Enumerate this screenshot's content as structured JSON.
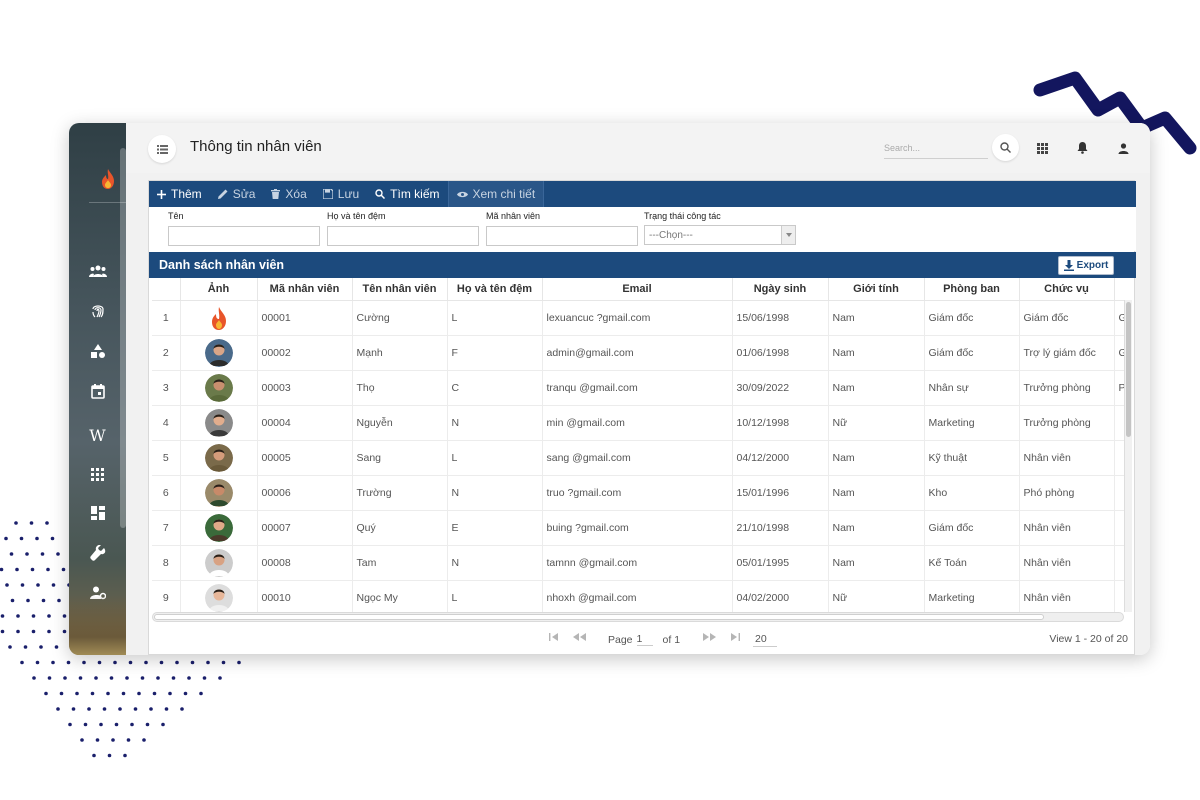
{
  "header": {
    "title": "Thông tin nhân viên",
    "search_placeholder": "Search..."
  },
  "toolbar": {
    "add": "Thêm",
    "edit": "Sửa",
    "delete": "Xóa",
    "save": "Lưu",
    "search": "Tìm kiếm",
    "view_detail": "Xem chi tiết"
  },
  "filters": {
    "first_name_label": "Tên",
    "last_name_label": "Họ và tên đệm",
    "employee_id_label": "Mã nhân viên",
    "status_label": "Trạng thái công tác",
    "status_selected": "---Chọn---"
  },
  "grid": {
    "title": "Danh sách nhân viên",
    "export_label": "Export",
    "columns": [
      "",
      "Ảnh",
      "Mã nhân viên",
      "Tên nhân viên",
      "Họ và tên đệm",
      "Email",
      "Ngày sinh",
      "Giới tính",
      "Phòng ban",
      "Chức vụ",
      ""
    ],
    "rows": [
      {
        "no": "1",
        "avatar": "logo",
        "id": "00001",
        "name": "Cường",
        "middle": "L",
        "email": "lexuancuc             ?gmail.com",
        "dob": "15/06/1998",
        "gender": "Nam",
        "dept": "Giám đốc",
        "position": "Giám đốc",
        "extra": "G"
      },
      {
        "no": "2",
        "avatar": "person",
        "id": "00002",
        "name": "Mạnh",
        "middle": "F",
        "email": "admin@gmail.com",
        "dob": "01/06/1998",
        "gender": "Nam",
        "dept": "Giám đốc",
        "position": "Trợ lý giám đốc",
        "extra": "G"
      },
      {
        "no": "3",
        "avatar": "person",
        "id": "00003",
        "name": "Thọ",
        "middle": "C",
        "email": "tranqu                   @gmail.com",
        "dob": "30/09/2022",
        "gender": "Nam",
        "dept": "Nhân sự",
        "position": "Trưởng phòng",
        "extra": "P"
      },
      {
        "no": "4",
        "avatar": "person",
        "id": "00004",
        "name": "Nguyễn",
        "middle": "N",
        "email": "min          @gmail.com",
        "dob": "10/12/1998",
        "gender": "Nữ",
        "dept": "Marketing",
        "position": "Trưởng phòng",
        "extra": ""
      },
      {
        "no": "5",
        "avatar": "person",
        "id": "00005",
        "name": "Sang",
        "middle": "L",
        "email": "sang                     @gmail.com",
        "dob": "04/12/2000",
        "gender": "Nam",
        "dept": "Kỹ thuật",
        "position": "Nhân viên",
        "extra": ""
      },
      {
        "no": "6",
        "avatar": "person",
        "id": "00006",
        "name": "Trường",
        "middle": "N",
        "email": "truo                 ?gmail.com",
        "dob": "15/01/1996",
        "gender": "Nam",
        "dept": "Kho",
        "position": "Phó phòng",
        "extra": ""
      },
      {
        "no": "7",
        "avatar": "person",
        "id": "00007",
        "name": "Quý",
        "middle": "E",
        "email": "buing               ?gmail.com",
        "dob": "21/10/1998",
        "gender": "Nam",
        "dept": "Giám đốc",
        "position": "Nhân viên",
        "extra": ""
      },
      {
        "no": "8",
        "avatar": "person",
        "id": "00008",
        "name": "Tam",
        "middle": "N",
        "email": "tamnn              @gmail.com",
        "dob": "05/01/1995",
        "gender": "Nam",
        "dept": "Kế Toán",
        "position": "Nhân viên",
        "extra": ""
      },
      {
        "no": "9",
        "avatar": "person",
        "id": "00010",
        "name": "Ngọc My",
        "middle": "L",
        "email": "nhoxh              @gmail.com",
        "dob": "04/02/2000",
        "gender": "Nữ",
        "dept": "Marketing",
        "position": "Nhân viên",
        "extra": ""
      }
    ]
  },
  "pager": {
    "page_label": "Page",
    "page_value": "1",
    "of_label": "of 1",
    "rows_per_page": "20",
    "view_text": "View 1 - 20 of 20"
  },
  "sidebar": {
    "items": [
      "logo",
      "users-icon",
      "fingerprint-icon",
      "shapes-icon",
      "calendar-icon",
      "wordpress-icon",
      "apps-icon",
      "dashboard-icon",
      "wrench-icon",
      "user-settings-icon"
    ]
  },
  "colors": {
    "primary": "#1c4a7d",
    "accent_zigzag": "#13165e",
    "dots": "#1a1f6b",
    "logo_flame": "#e8552a"
  }
}
